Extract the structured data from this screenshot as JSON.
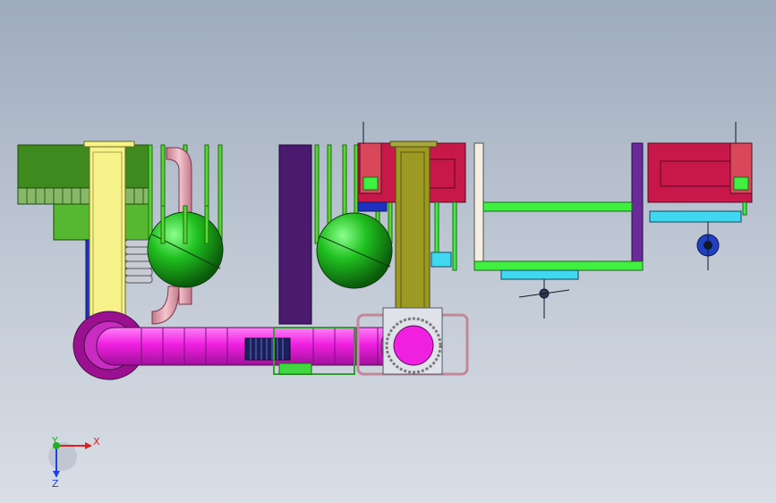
{
  "viewport": {
    "background_top": "#9eabbd",
    "background_bottom": "#d9dee6"
  },
  "triad": {
    "x_label": "X",
    "y_label": "Y",
    "z_label": "Z",
    "x_color": "#e02020",
    "y_color": "#20b020",
    "z_color": "#2040e0"
  },
  "colors": {
    "green_block": "#3f8a1f",
    "green_light": "#55b830",
    "yellow": "#f7f38a",
    "olive": "#9c9a22",
    "purple": "#4a1a6e",
    "violet": "#6a2a9a",
    "magenta": "#f020e0",
    "sphere": "#20c020",
    "crimson": "#c8184a",
    "cyan": "#40d8f0",
    "lime": "#40f040",
    "pink_pipe": "#e8a0b0",
    "dark_navy": "#101830"
  }
}
